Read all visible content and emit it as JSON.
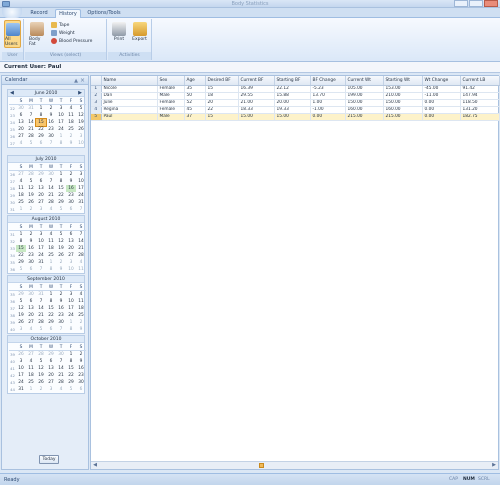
{
  "window": {
    "title": "Body Statistics"
  },
  "tabs": [
    {
      "label": "Record"
    },
    {
      "label": "History"
    },
    {
      "label": "Options/Tools"
    }
  ],
  "ribbon": {
    "user_group": {
      "label": "User",
      "all_users": "All Users"
    },
    "views_group": {
      "label": "Views (select)",
      "body_fat": "Body Fat",
      "tape": "Tape",
      "weight": "Weight",
      "blood_pressure": "Blood Pressure"
    },
    "activities_group": {
      "label": "Activities",
      "print": "Print",
      "export": "Export"
    }
  },
  "current_user": "Current User: Paul",
  "calendar_panel": {
    "title": "Calendar",
    "today_button": "Today",
    "months": [
      {
        "name": "June 2010",
        "weeks": [
          [
            "22",
            "30",
            "31",
            "1",
            "2",
            "3",
            "4",
            "5"
          ],
          [
            "23",
            "6",
            "7",
            "8",
            "9",
            "10",
            "11",
            "12"
          ],
          [
            "24",
            "13",
            "14",
            "15",
            "16",
            "17",
            "18",
            "19"
          ],
          [
            "25",
            "20",
            "21",
            "22",
            "23",
            "24",
            "25",
            "26"
          ],
          [
            "26",
            "27",
            "28",
            "29",
            "30",
            "1",
            "2",
            "3"
          ],
          [
            "27",
            "4",
            "5",
            "6",
            "7",
            "8",
            "9",
            "10"
          ]
        ]
      },
      {
        "name": "July 2010",
        "weeks": [
          [
            "26",
            "27",
            "28",
            "29",
            "30",
            "1",
            "2",
            "3"
          ],
          [
            "27",
            "4",
            "5",
            "6",
            "7",
            "8",
            "9",
            "10"
          ],
          [
            "28",
            "11",
            "12",
            "13",
            "14",
            "15",
            "16",
            "17"
          ],
          [
            "29",
            "18",
            "19",
            "20",
            "21",
            "22",
            "23",
            "24"
          ],
          [
            "30",
            "25",
            "26",
            "27",
            "28",
            "29",
            "30",
            "31"
          ],
          [
            "31",
            "1",
            "2",
            "3",
            "4",
            "5",
            "6",
            "7"
          ]
        ]
      },
      {
        "name": "August 2010",
        "weeks": [
          [
            "31",
            "1",
            "2",
            "3",
            "4",
            "5",
            "6",
            "7"
          ],
          [
            "32",
            "8",
            "9",
            "10",
            "11",
            "12",
            "13",
            "14"
          ],
          [
            "33",
            "15",
            "16",
            "17",
            "18",
            "19",
            "20",
            "21"
          ],
          [
            "34",
            "22",
            "23",
            "24",
            "25",
            "26",
            "27",
            "28"
          ],
          [
            "35",
            "29",
            "30",
            "31",
            "1",
            "2",
            "3",
            "4"
          ],
          [
            "36",
            "5",
            "6",
            "7",
            "8",
            "9",
            "10",
            "11"
          ]
        ]
      },
      {
        "name": "September 2010",
        "weeks": [
          [
            "35",
            "29",
            "30",
            "31",
            "1",
            "2",
            "3",
            "4"
          ],
          [
            "36",
            "5",
            "6",
            "7",
            "8",
            "9",
            "10",
            "11"
          ],
          [
            "37",
            "12",
            "13",
            "14",
            "15",
            "16",
            "17",
            "18"
          ],
          [
            "38",
            "19",
            "20",
            "21",
            "22",
            "23",
            "24",
            "25"
          ],
          [
            "39",
            "26",
            "27",
            "28",
            "29",
            "30",
            "1",
            "2"
          ],
          [
            "40",
            "3",
            "4",
            "5",
            "6",
            "7",
            "8",
            "9"
          ]
        ]
      },
      {
        "name": "October 2010",
        "weeks": [
          [
            "39",
            "26",
            "27",
            "28",
            "29",
            "30",
            "1",
            "2"
          ],
          [
            "40",
            "3",
            "4",
            "5",
            "6",
            "7",
            "8",
            "9"
          ],
          [
            "41",
            "10",
            "11",
            "12",
            "13",
            "14",
            "15",
            "16"
          ],
          [
            "42",
            "17",
            "18",
            "19",
            "20",
            "21",
            "22",
            "23"
          ],
          [
            "43",
            "24",
            "25",
            "26",
            "27",
            "28",
            "29",
            "30"
          ],
          [
            "44",
            "31",
            "1",
            "2",
            "3",
            "4",
            "5",
            "6"
          ]
        ]
      }
    ],
    "day_names": [
      "S",
      "M",
      "T",
      "W",
      "T",
      "F",
      "S"
    ]
  },
  "grid": {
    "columns": [
      "Name",
      "Sex",
      "Age",
      "Desired BF",
      "Current BF",
      "Starting BF",
      "BF Change",
      "Current Wt",
      "Starting Wt",
      "Wt Change",
      "Current LB"
    ],
    "rows": [
      {
        "num": "1",
        "cells": [
          "Nicole",
          "Female",
          "35",
          "15",
          "16.39",
          "22.12",
          "-5.23",
          "105.00",
          "153.00",
          "-45.00",
          "91.42"
        ]
      },
      {
        "num": "2",
        "cells": [
          "Dan",
          "Male",
          "50",
          "18",
          "29.55",
          "15.88",
          "13.70",
          "199.00",
          "210.00",
          "-11.00",
          "147.94"
        ]
      },
      {
        "num": "3",
        "cells": [
          "Julie",
          "Female",
          "52",
          "20",
          "21.00",
          "20.00",
          "1.00",
          "150.00",
          "150.00",
          "0.00",
          "118.50"
        ]
      },
      {
        "num": "4",
        "cells": [
          "Regina",
          "Female",
          "45",
          "22",
          "18.33",
          "19.33",
          "-1.00",
          "160.00",
          "160.00",
          "0.00",
          "131.20"
        ]
      },
      {
        "num": "5",
        "cells": [
          "Paul",
          "Male",
          "37",
          "15",
          "15.00",
          "15.00",
          "0.00",
          "215.00",
          "215.00",
          "0.00",
          "182.75"
        ]
      }
    ]
  },
  "status": {
    "text": "Ready",
    "indicators": [
      "CAP",
      "NUM",
      "SCRL"
    ]
  }
}
